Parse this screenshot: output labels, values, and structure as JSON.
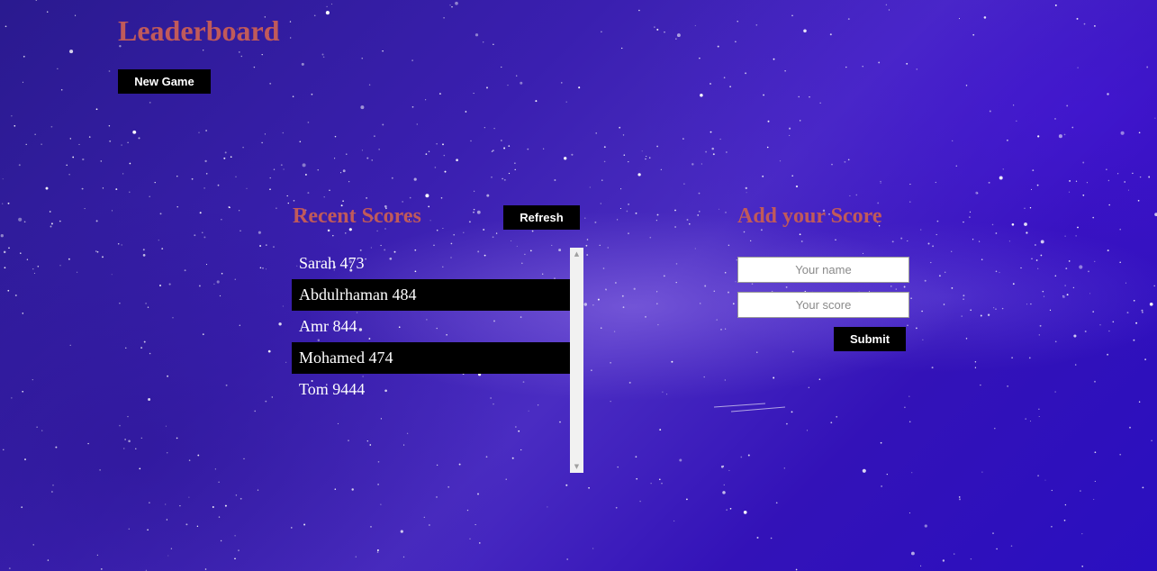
{
  "header": {
    "title": "Leaderboard",
    "new_game_label": "New Game"
  },
  "recent": {
    "heading": "Recent Scores",
    "refresh_label": "Refresh",
    "scores": [
      "Sarah 473",
      "Abdulrhaman 484",
      "Amr 844",
      "Mohamed 474",
      "Tom 9444"
    ]
  },
  "add_score": {
    "heading": "Add your Score",
    "name_placeholder": "Your name",
    "score_placeholder": "Your score",
    "submit_label": "Submit"
  },
  "icons": {
    "scroll_up": "scroll-up-arrow-icon",
    "scroll_down": "scroll-down-arrow-icon"
  },
  "colors": {
    "heading": "#c05a5a",
    "button_bg": "#000000",
    "row_highlight": "#000000"
  }
}
